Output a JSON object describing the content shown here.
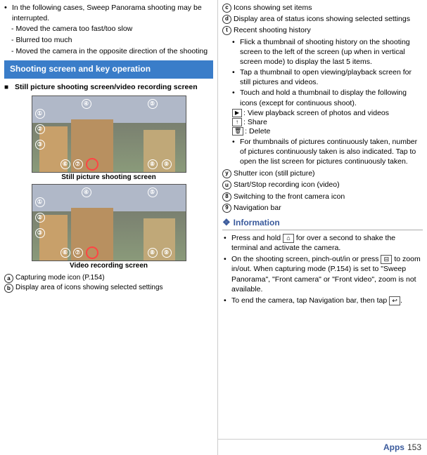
{
  "left": {
    "bullet_intro": "In the following cases, Sweep Panorama shooting may be interrupted.",
    "dash_items": [
      "Moved the camera too fast/too slow",
      "Blurred too much",
      "Moved the camera in the opposite direction of the shooting"
    ],
    "blue_header": "Shooting screen and key operation",
    "section_heading": "Still picture shooting screen/video recording screen",
    "screen1_label": "Still picture shooting screen",
    "screen2_label": "Video recording screen",
    "alpha_labels": [
      {
        "letter": "a",
        "text": "Capturing mode icon (P.154)"
      },
      {
        "letter": "b",
        "text": "Display area of icons showing selected settings"
      }
    ]
  },
  "right": {
    "items": [
      {
        "letter": "c",
        "text": "Icons showing set items"
      },
      {
        "letter": "d",
        "text": "Display area of status icons showing selected settings"
      },
      {
        "letter": "t",
        "text": "Recent shooting history"
      }
    ],
    "history_bullets": [
      "Flick a thumbnail of shooting history on the shooting screen to the left of the screen (up when in vertical screen mode) to display the last 5 items.",
      "Tap a thumbnail to open viewing/playback screen for still pictures and videos.",
      "Touch and hold a thumbnail to display the following icons (except for continuous shoot)."
    ],
    "icon_labels": [
      {
        "icon": "▶",
        "text": ": View playback screen of photos and videos"
      },
      {
        "icon": "⬆",
        "text": ": Share"
      },
      {
        "icon": "🗑",
        "text": ": Delete"
      }
    ],
    "history_bullet4": "For thumbnails of pictures continuously taken, number of pictures continuously taken is also indicated. Tap to open the list screen for pictures continuously taken.",
    "items2": [
      {
        "letter": "y",
        "text": "Shutter icon (still picture)"
      },
      {
        "letter": "u",
        "text": "Start/Stop recording icon (video)"
      },
      {
        "letter": "8",
        "text": "Switching to the front camera icon"
      },
      {
        "letter": "9",
        "text": "Navigation bar"
      }
    ],
    "info_header": "Information",
    "info_bullets": [
      "Press and hold  for over a second to shake the terminal and activate the camera.",
      "On the shooting screen, pinch-out/in or press  to zoom in/out. When capturing mode (P.154) is set to \"Sweep Panorama\", \"Front camera\" or \"Front video\", zoom is not available.",
      "To end the camera, tap Navigation bar, then tap ."
    ]
  },
  "footer": {
    "apps_label": "Apps",
    "page_number": "153"
  }
}
